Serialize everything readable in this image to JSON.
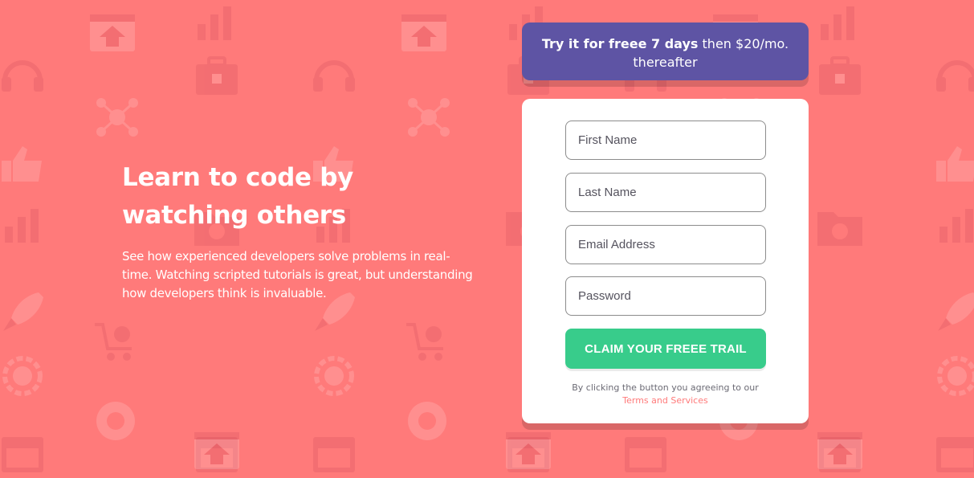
{
  "colors": {
    "background": "#ff7a7a",
    "promo_bg": "#5e54a4",
    "button_bg": "#38cc8b",
    "link": "#ff7a7a"
  },
  "hero": {
    "title": "Learn to code by watching others",
    "description": "See how experienced developers solve problems in real-time. Watching scripted tutorials is great, but understanding how developers think is invaluable."
  },
  "promo": {
    "bold": "Try it for freee 7 days",
    "rest": " then $20/mo. thereafter"
  },
  "form": {
    "first_name_placeholder": "First Name",
    "last_name_placeholder": "Last Name",
    "email_placeholder": "Email Address",
    "password_placeholder": "Password",
    "submit_label": "CLAIM YOUR FREEE TRAIL",
    "terms_text": "By clicking the button you agreeing to our",
    "terms_link": "Terms and Services"
  },
  "background_icons": [
    "browser-upload-icon",
    "toolbox-icon",
    "headset-icon",
    "network-icon",
    "thumbs-up-icon",
    "chart-icon",
    "folder-settings-icon",
    "rocket-icon",
    "shopping-cart-icon",
    "globe-gear-icon",
    "lifebuoy-icon",
    "calendar-icon"
  ]
}
